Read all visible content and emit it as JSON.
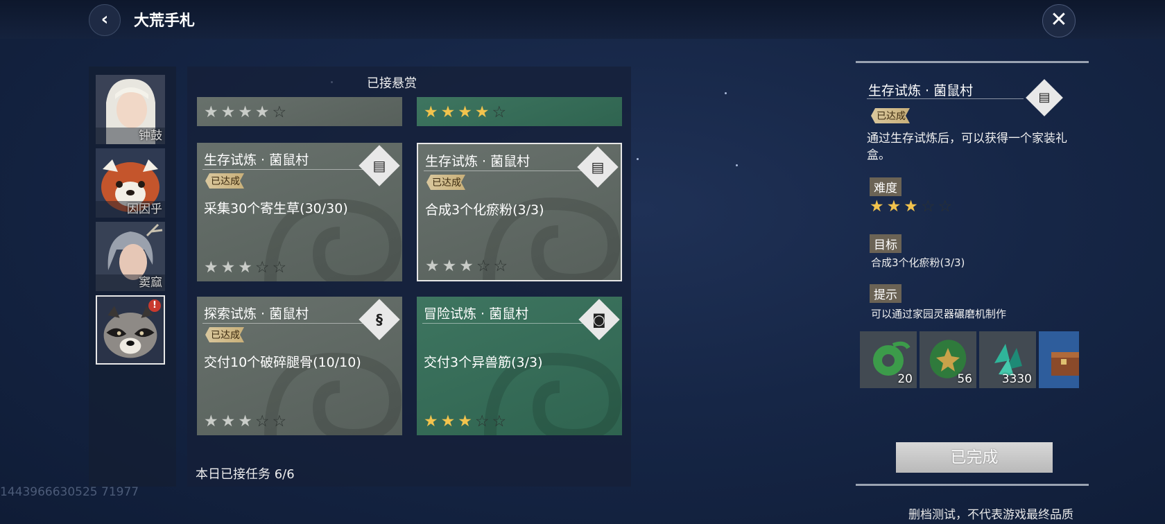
{
  "header": {
    "title": "大荒手札"
  },
  "characters": [
    {
      "name": "钟鼓",
      "selected": false,
      "alert": false
    },
    {
      "name": "因因乎",
      "selected": false,
      "alert": false
    },
    {
      "name": "窦窳",
      "selected": false,
      "alert": false
    },
    {
      "name": "",
      "selected": true,
      "alert": true,
      "alert_text": "!"
    }
  ],
  "quests": {
    "panel_title": "已接悬赏",
    "partial_top": [
      {
        "style": "grey",
        "stars_filled": 4,
        "stars_total": 5
      },
      {
        "style": "green",
        "stars_filled": 4,
        "stars_total": 5
      }
    ],
    "cards": [
      {
        "title": "生存试炼 · 菌鼠村",
        "tag": "已达成",
        "objective": "采集30个寄生草(30/30)",
        "style": "grey",
        "icon": "scroll-icon",
        "stars_filled": 3,
        "stars_total": 5,
        "selected": false
      },
      {
        "title": "生存试炼 · 菌鼠村",
        "tag": "已达成",
        "objective": "合成3个化瘀粉(3/3)",
        "style": "grey",
        "icon": "scroll-icon",
        "stars_filled": 3,
        "stars_total": 5,
        "selected": true
      },
      {
        "title": "探索试炼 · 菌鼠村",
        "tag": "已达成",
        "objective": "交付10个破碎腿骨(10/10)",
        "style": "grey",
        "icon": "dragon-icon",
        "stars_filled": 3,
        "stars_total": 5,
        "selected": false
      },
      {
        "title": "冒险试炼 · 菌鼠村",
        "tag": "",
        "objective": "交付3个异兽筋(3/3)",
        "style": "green",
        "icon": "mask-icon",
        "stars_filled": 3,
        "stars_total": 5,
        "selected": false
      }
    ],
    "daily_text": "本日已接任务 6/6"
  },
  "detail": {
    "title": "生存试炼 · 菌鼠村",
    "tag": "已达成",
    "description": "通过生存试炼后，可以获得一个家装礼盒。",
    "difficulty_label": "难度",
    "difficulty_stars": 3,
    "difficulty_total": 5,
    "goal_label": "目标",
    "goal_text": "合成3个化瘀粉(3/3)",
    "hint_label": "提示",
    "hint_text": "可以通过家园灵器碾磨机制作",
    "rewards": [
      {
        "icon": "jade-ring-icon",
        "count": "20"
      },
      {
        "icon": "green-seed-icon",
        "count": "56"
      },
      {
        "icon": "crystal-shard-icon",
        "count": "3330"
      },
      {
        "icon": "treasure-chest-icon",
        "count": ""
      }
    ],
    "complete_button": "已完成"
  },
  "footer_note": "删档测试，不代表游戏最终品质",
  "uid": "1443966630525 71977",
  "colors": {
    "star_on": "#f2c34d",
    "green_card": "#3e7560",
    "grey_card": "#68716c"
  }
}
